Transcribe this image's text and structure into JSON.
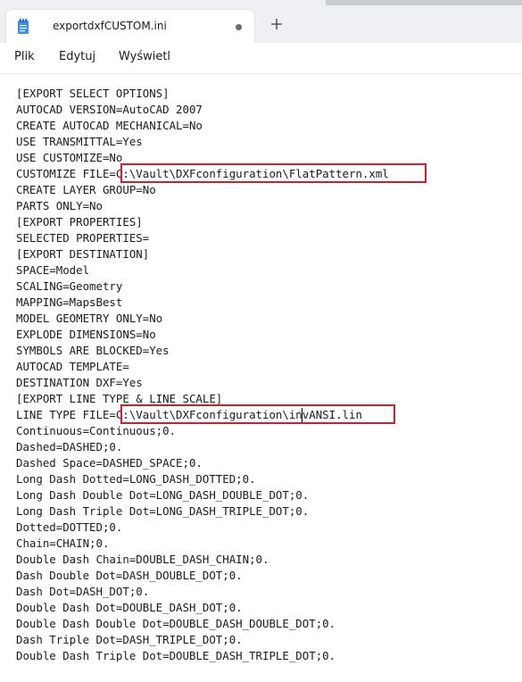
{
  "window": {
    "tab_title": "exportdxfCUSTOM.ini",
    "tab_icon": "notepad-document-icon",
    "unsaved_indicator": "dot",
    "new_tab_icon": "plus-icon"
  },
  "menu": {
    "file": "Plik",
    "edit": "Edytuj",
    "view": "Wyświetl"
  },
  "document": {
    "lines": [
      "[EXPORT SELECT OPTIONS]",
      "AUTOCAD VERSION=AutoCAD 2007",
      "CREATE AUTOCAD MECHANICAL=No",
      "USE TRANSMITTAL=Yes",
      "USE CUSTOMIZE=No",
      "CUSTOMIZE FILE=C:\\Vault\\DXFconfiguration\\FlatPattern.xml",
      "CREATE LAYER GROUP=No",
      "PARTS ONLY=No",
      "[EXPORT PROPERTIES]",
      "SELECTED PROPERTIES=",
      "[EXPORT DESTINATION]",
      "SPACE=Model",
      "SCALING=Geometry",
      "MAPPING=MapsBest",
      "MODEL GEOMETRY ONLY=No",
      "EXPLODE DIMENSIONS=No",
      "SYMBOLS ARE BLOCKED=Yes",
      "AUTOCAD TEMPLATE=",
      "DESTINATION DXF=Yes",
      "[EXPORT LINE TYPE & LINE SCALE]",
      "LINE TYPE FILE=C:\\Vault\\DXFconfiguration\\invANSI.lin",
      "Continuous=Continuous;0.",
      "Dashed=DASHED;0.",
      "Dashed Space=DASHED_SPACE;0.",
      "Long Dash Dotted=LONG_DASH_DOTTED;0.",
      "Long Dash Double Dot=LONG_DASH_DOUBLE_DOT;0.",
      "Long Dash Triple Dot=LONG_DASH_TRIPLE_DOT;0.",
      "Dotted=DOTTED;0.",
      "Chain=CHAIN;0.",
      "Double Dash Chain=DOUBLE_DASH_CHAIN;0.",
      "Dash Double Dot=DASH_DOUBLE_DOT;0.",
      "Dash Dot=DASH_DOT;0.",
      "Double Dash Dot=DOUBLE_DASH_DOT;0.",
      "Double Dash Double Dot=DOUBLE_DASH_DOUBLE_DOT;0.",
      "Dash Triple Dot=DASH_TRIPLE_DOT;0.",
      "Double Dash Triple Dot=DOUBLE_DASH_TRIPLE_DOT;0."
    ]
  },
  "colors": {
    "highlight_box": "#d01f2b",
    "titlebar": "#eef0f3",
    "text": "#1a1a1a"
  }
}
